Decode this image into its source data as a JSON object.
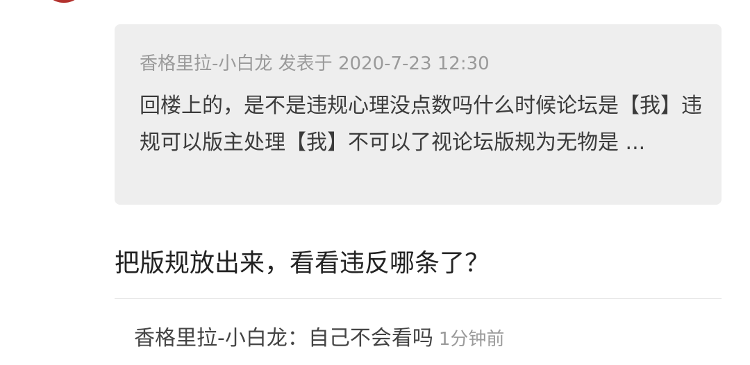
{
  "quote": {
    "author": "香格里拉-小白龙",
    "posted_label": "发表于",
    "datetime": "2020-7-23 12:30",
    "text": "回楼上的，是不是违规心理没点数吗什么时候论坛是【我】违规可以版主处理【我】不可以了视论坛版规为无物是 ..."
  },
  "reply": {
    "text": "把版规放出来，看看违反哪条了？"
  },
  "sub_comment": {
    "author": "香格里拉-小白龙",
    "separator": "：",
    "text": "自己不会看吗",
    "time": "1分钟前"
  },
  "colors": {
    "avatar": "#b3322e",
    "quote_bg": "#eeeeee",
    "meta_text": "#9a9a9a",
    "body_text": "#3b3b3b"
  }
}
